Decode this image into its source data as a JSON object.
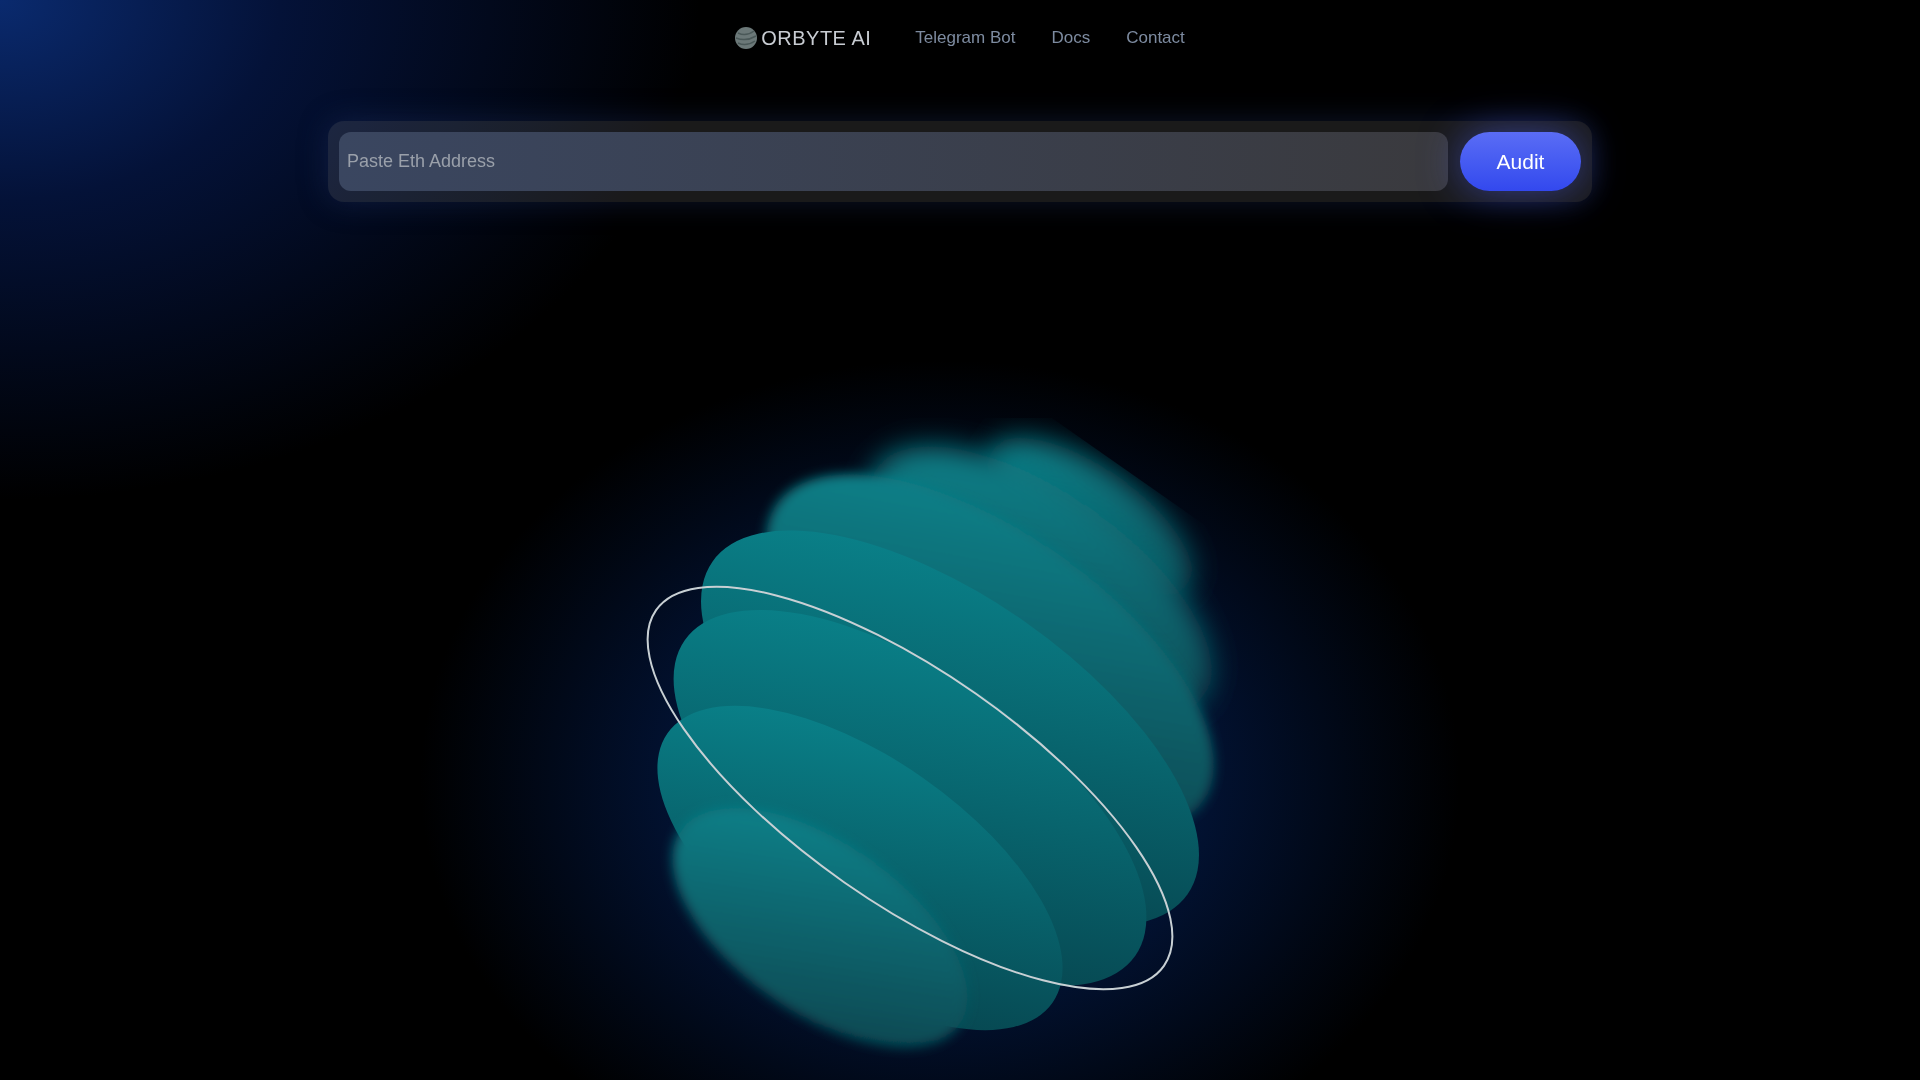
{
  "nav": {
    "brand": "ORBYTE AI",
    "links": [
      {
        "label": "Telegram Bot"
      },
      {
        "label": "Docs"
      },
      {
        "label": "Contact"
      }
    ]
  },
  "search": {
    "placeholder": "Paste Eth Address",
    "button": "Audit"
  }
}
